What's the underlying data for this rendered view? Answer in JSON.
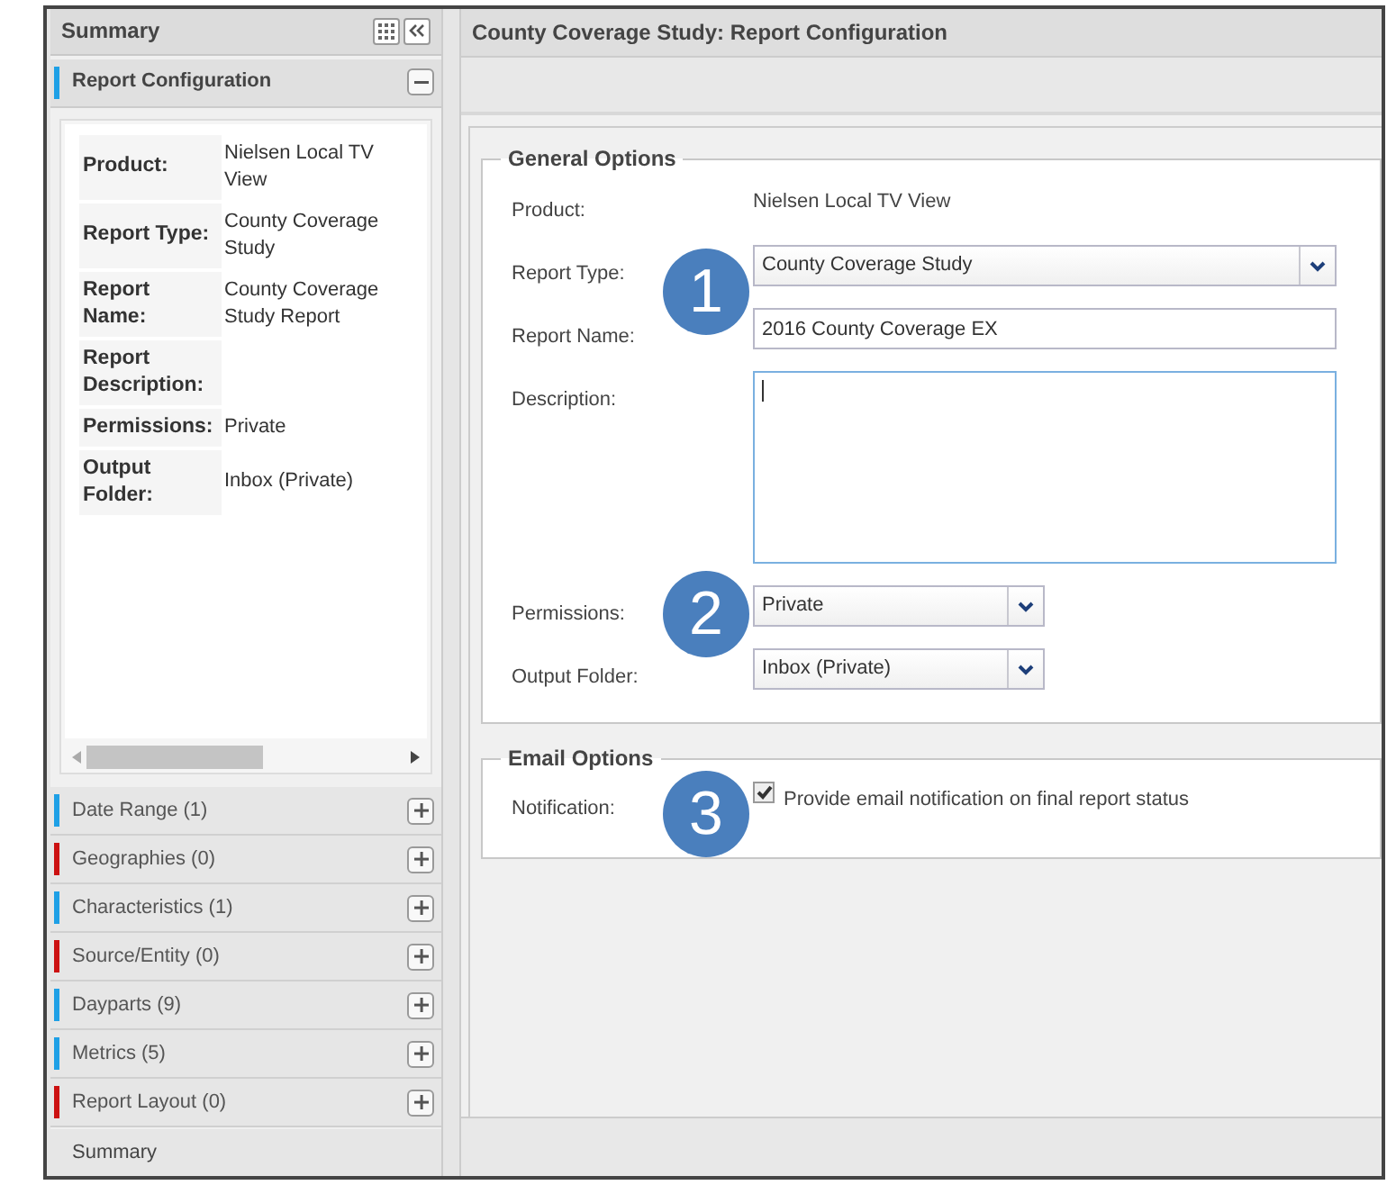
{
  "sidebar": {
    "title": "Summary",
    "section": {
      "title": "Report Configuration",
      "expanded": true,
      "color": "#1ea0e6",
      "details": [
        {
          "label": "Product:",
          "value": "Nielsen Local TV View"
        },
        {
          "label": "Report Type:",
          "value": "County Coverage Study"
        },
        {
          "label": "Report Name:",
          "value": "County Coverage Study Report"
        },
        {
          "label": "Report Description:"
        },
        {
          "label": "Permissions:",
          "value": "Private"
        },
        {
          "label": "Output Folder:",
          "value": "Inbox (Private)"
        }
      ]
    },
    "items": [
      {
        "label": "Date Range (1)",
        "color": "#1ea0e6"
      },
      {
        "label": "Geographies (0)",
        "color": "#cc1111"
      },
      {
        "label": "Characteristics (1)",
        "color": "#1ea0e6"
      },
      {
        "label": "Source/Entity (0)",
        "color": "#cc1111"
      },
      {
        "label": "Dayparts (9)",
        "color": "#1ea0e6"
      },
      {
        "label": "Metrics (5)",
        "color": "#1ea0e6"
      },
      {
        "label": "Report Layout (0)",
        "color": "#cc1111"
      }
    ],
    "footer": "Summary"
  },
  "main": {
    "title": "County Coverage Study: Report Configuration",
    "general": {
      "legend": "General Options",
      "fields": [
        {
          "kind": "text",
          "label": "Product:",
          "value": "Nielsen Local TV View"
        },
        {
          "kind": "select",
          "label": "Report Type:",
          "value": "County Coverage Study",
          "wide": true
        },
        {
          "kind": "input",
          "label": "Report Name:",
          "value": "2016 County Coverage EX"
        },
        {
          "kind": "textarea",
          "label": "Description:"
        },
        {
          "kind": "select",
          "label": "Permissions:",
          "value": "Private",
          "wide": false
        },
        {
          "kind": "select",
          "label": "Output Folder:",
          "value": "Inbox (Private)",
          "wide": false
        }
      ]
    },
    "email": {
      "legend": "Email Options",
      "label": "Notification:",
      "checkbox": {
        "label": "Provide email notification on final report status",
        "checked": true
      }
    }
  },
  "callouts": [
    {
      "number": "1"
    },
    {
      "number": "2"
    },
    {
      "number": "3"
    }
  ]
}
